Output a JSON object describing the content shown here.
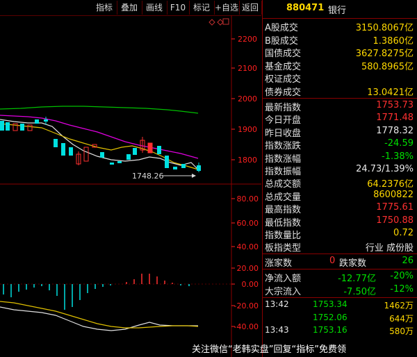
{
  "toolbar": {
    "buttons": [
      "指标",
      "叠加",
      "画线",
      "F10",
      "标记",
      "+自选",
      "返回"
    ]
  },
  "chart": {
    "price_axis": [
      "2200",
      "2100",
      "2000",
      "1900",
      "1800"
    ],
    "indicator_axis": [
      "80.00",
      "60.00",
      "40.00",
      "20.00",
      "0.00",
      "-20.00",
      "-40.00"
    ],
    "low_annotation": "1748.26"
  },
  "panel": {
    "code": "880471",
    "name": "银行",
    "turnover": [
      {
        "label": "A股成交",
        "value": "3150.8067亿"
      },
      {
        "label": "B股成交",
        "value": "1.3860亿"
      },
      {
        "label": "国债成交",
        "value": "3627.8275亿"
      },
      {
        "label": "基金成交",
        "value": "580.8965亿"
      },
      {
        "label": "权证成交",
        "value": ""
      },
      {
        "label": "债券成交",
        "value": "13.0421亿"
      }
    ],
    "index_stats": [
      {
        "label": "最新指数",
        "value": "1753.73"
      },
      {
        "label": "今日开盘",
        "value": "1771.48"
      },
      {
        "label": "昨日收盘",
        "value": "1778.32"
      },
      {
        "label": "指数涨跌",
        "value": "-24.59"
      },
      {
        "label": "指数涨幅",
        "value": "-1.38%"
      },
      {
        "label": "指数振幅",
        "value": "24.73/1.39%"
      },
      {
        "label": "总成交额",
        "value": "64.2376亿"
      },
      {
        "label": "总成交量",
        "value": "8600822"
      },
      {
        "label": "最高指数",
        "value": "1775.61"
      },
      {
        "label": "最低指数",
        "value": "1750.88"
      },
      {
        "label": "指数量比",
        "value": "0.72"
      },
      {
        "label": "板指类型",
        "value": "行业 成份股"
      }
    ],
    "breadth": {
      "up_label": "涨家数",
      "up_value": "0",
      "down_label": "跌家数",
      "down_value": "26"
    },
    "flows": [
      {
        "label": "净流入额",
        "value1": "-12.77亿",
        "value2": "-20%"
      },
      {
        "label": "大宗流入",
        "value1": "-7.50亿",
        "value2": "-12%"
      }
    ],
    "ticks": [
      {
        "time": "13:42",
        "price": "1753.34",
        "volume": "1462万"
      },
      {
        "time": "",
        "price": "1752.06",
        "volume": "644万"
      },
      {
        "time": "13:43",
        "price": "1753.16",
        "volume": "580万"
      }
    ]
  },
  "watermark": "关注微信“老韩实盘”回复“指标”免费领",
  "colors": {
    "up": "#ff3030",
    "down": "#00e0e0",
    "axis": "#ff2020",
    "grid": "#8a0000"
  }
}
